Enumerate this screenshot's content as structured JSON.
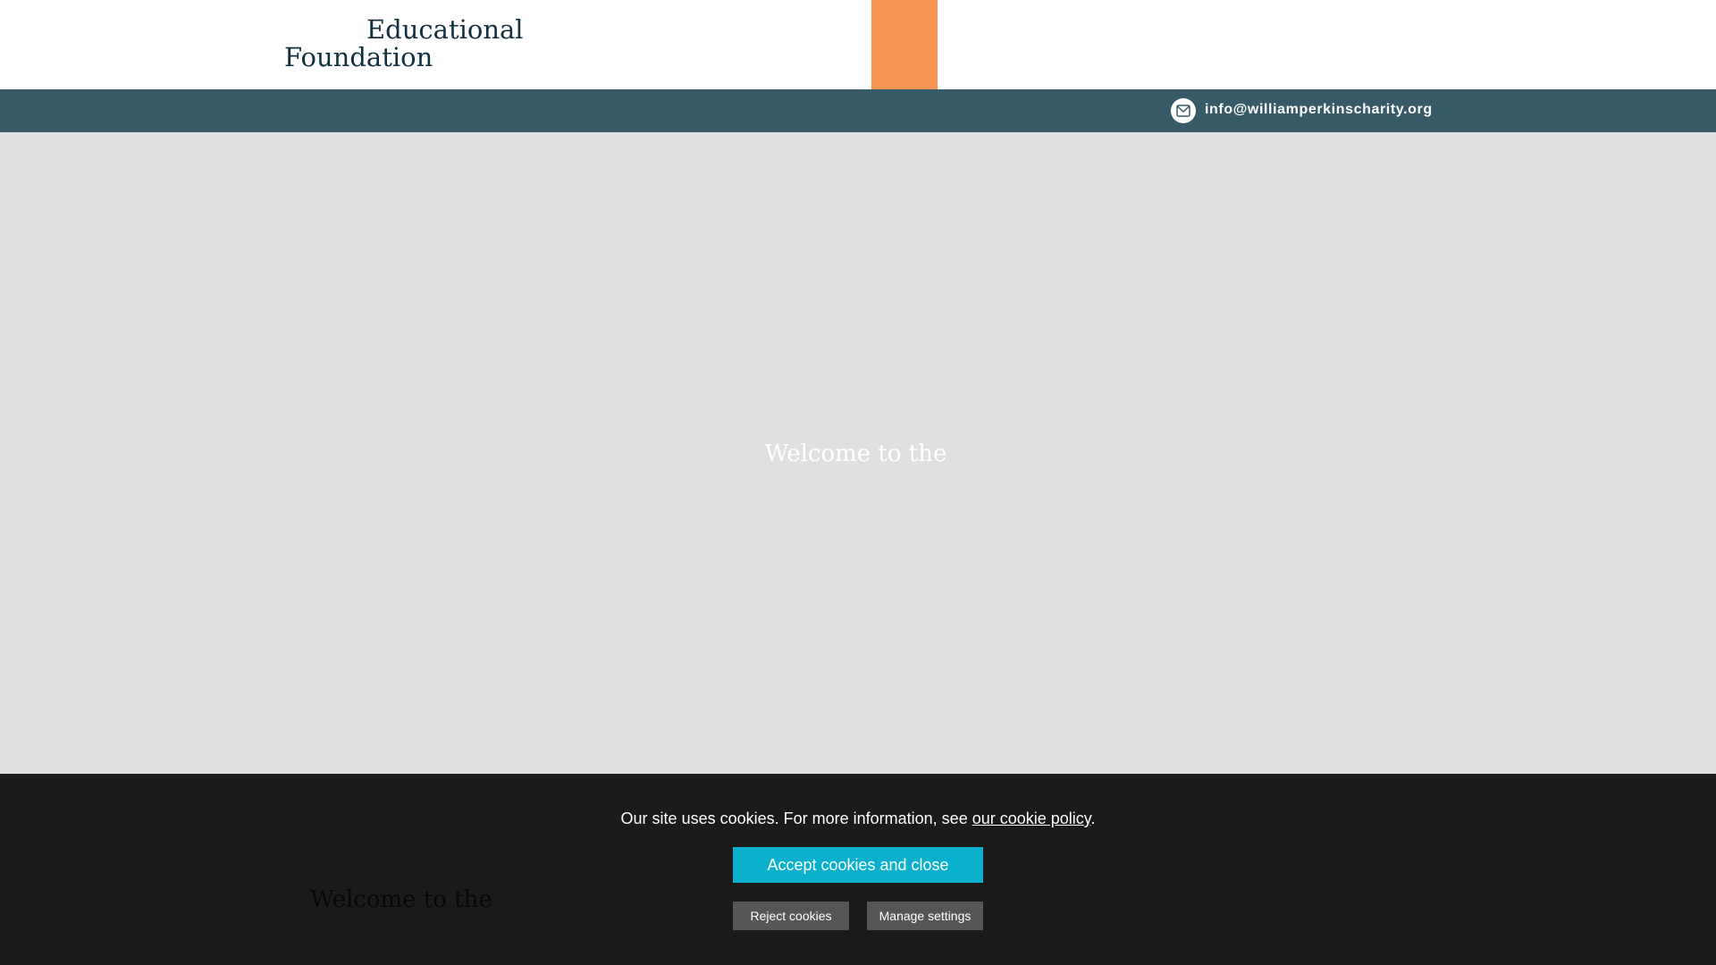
{
  "header": {
    "logo_line1": "Educational",
    "logo_line2": "Foundation"
  },
  "info_bar": {
    "email": "info@williamperkinscharity.org",
    "icon": "mail-icon"
  },
  "hero": {
    "title": "Welcome to the"
  },
  "section": {
    "heading": "Welcome to the"
  },
  "cookie_banner": {
    "text_before": "Our site uses cookies. For more information, see ",
    "policy_link": "our cookie policy",
    "text_after": ".",
    "accept_label": "Accept cookies and close",
    "reject_label": "Reject cookies",
    "manage_label": "Manage settings"
  },
  "colors": {
    "accent_orange": "#f79553",
    "info_bar": "#375a68",
    "accept_button": "#0bb1cc",
    "banner_background": "#1b1b1b"
  }
}
